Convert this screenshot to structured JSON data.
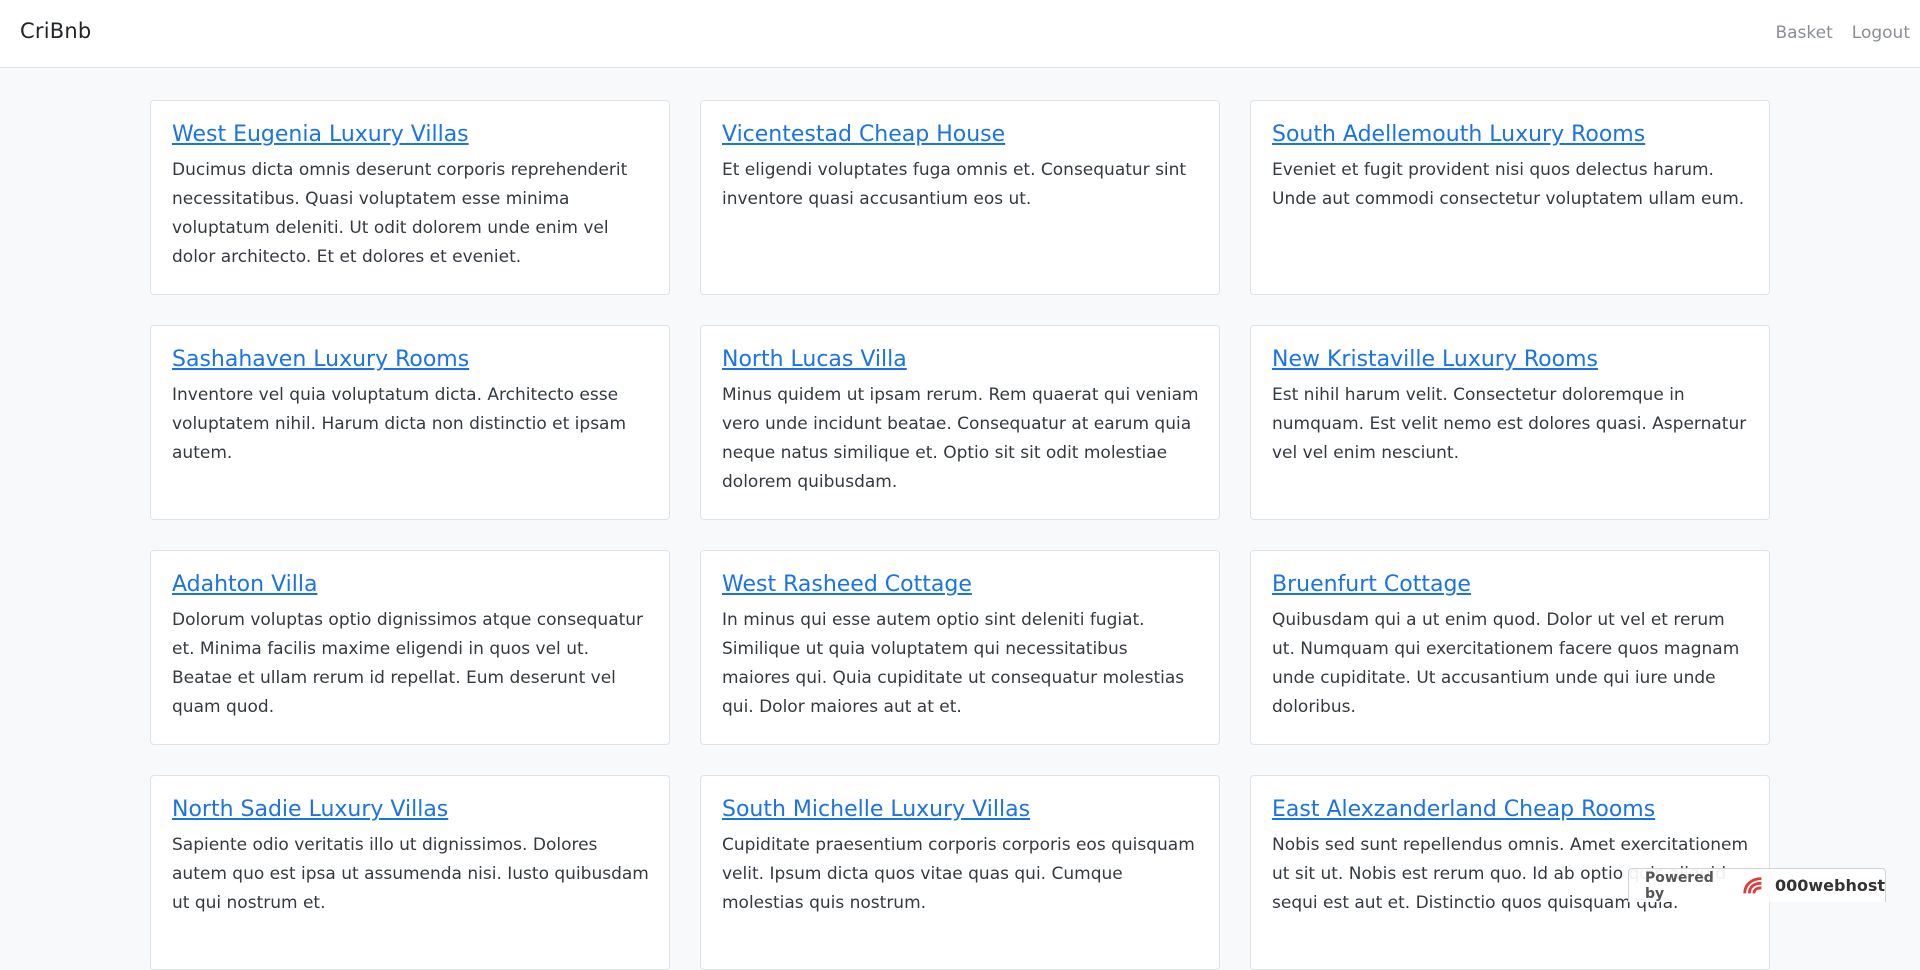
{
  "navbar": {
    "brand": "CriBnb",
    "links": [
      "Basket",
      "Logout"
    ]
  },
  "listings": [
    {
      "title": "West Eugenia Luxury Villas",
      "description": "Ducimus dicta omnis deserunt corporis reprehenderit necessitatibus. Quasi voluptatem esse minima voluptatum deleniti. Ut odit dolorem unde enim vel dolor architecto. Et et dolores et eveniet."
    },
    {
      "title": "Vicentestad Cheap House",
      "description": "Et eligendi voluptates fuga omnis et. Consequatur sint inventore quasi accusantium eos ut."
    },
    {
      "title": "South Adellemouth Luxury Rooms",
      "description": "Eveniet et fugit provident nisi quos delectus harum. Unde aut commodi consectetur voluptatem ullam eum."
    },
    {
      "title": "Sashahaven Luxury Rooms",
      "description": "Inventore vel quia voluptatum dicta. Architecto esse voluptatem nihil. Harum dicta non distinctio et ipsam autem."
    },
    {
      "title": "North Lucas Villa",
      "description": "Minus quidem ut ipsam rerum. Rem quaerat qui veniam vero unde incidunt beatae. Consequatur at earum quia neque natus similique et. Optio sit sit odit molestiae dolorem quibusdam."
    },
    {
      "title": "New Kristaville Luxury Rooms",
      "description": "Est nihil harum velit. Consectetur doloremque in numquam. Est velit nemo est dolores quasi. Aspernatur vel vel enim nesciunt."
    },
    {
      "title": "Adahton Villa",
      "description": "Dolorum voluptas optio dignissimos atque consequatur et. Minima facilis maxime eligendi in quos vel ut. Beatae et ullam rerum id repellat. Eum deserunt vel quam quod."
    },
    {
      "title": "West Rasheed Cottage",
      "description": "In minus qui esse autem optio sint deleniti fugiat. Similique ut quia voluptatem qui necessitatibus maiores qui. Quia cupiditate ut consequatur molestias qui. Dolor maiores aut at et."
    },
    {
      "title": "Bruenfurt Cottage",
      "description": "Quibusdam qui a ut enim quod. Dolor ut vel et rerum ut. Numquam qui exercitationem facere quos magnam unde cupiditate. Ut accusantium unde qui iure unde doloribus."
    },
    {
      "title": "North Sadie Luxury Villas",
      "description": "Sapiente odio veritatis illo ut dignissimos. Dolores autem quo est ipsa ut assumenda nisi. Iusto quibusdam ut qui nostrum et."
    },
    {
      "title": "South Michelle Luxury Villas",
      "description": "Cupiditate praesentium corporis corporis eos quisquam velit. Ipsum dicta quos vitae quas qui. Cumque molestias quis nostrum."
    },
    {
      "title": "East Alexzanderland Cheap Rooms",
      "description": "Nobis sed sunt repellendus omnis. Amet exercitationem ut sit ut. Nobis est rerum quo. Id ab optio quis aliquid sequi est aut et. Distinctio quos quisquam quia."
    }
  ],
  "hosting_badge": {
    "prefix": "Powered by",
    "name": "000webhost"
  }
}
